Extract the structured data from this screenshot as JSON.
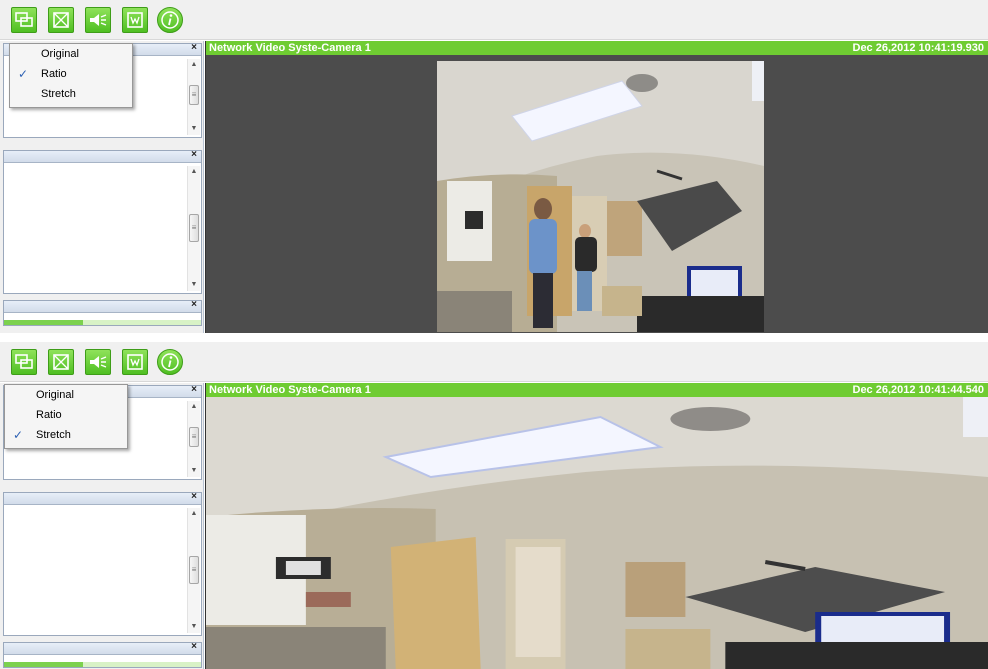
{
  "colors": {
    "accent_green": "#6fcc32",
    "video_background": "#4c4c4c",
    "toolbar_background": "#f0f0f0",
    "check_blue": "#2e62b4"
  },
  "toolbar": {
    "buttons": [
      {
        "icon": "monitor-layout-icon"
      },
      {
        "icon": "fullscreen-icon"
      },
      {
        "icon": "speaker-icon"
      },
      {
        "icon": "window-icon"
      },
      {
        "icon": "info-icon"
      }
    ]
  },
  "screens": [
    {
      "scale_menu": {
        "items": [
          "Original",
          "Ratio",
          "Stretch"
        ],
        "selected": "Ratio"
      },
      "panels": {
        "close_glyph": "×"
      },
      "video": {
        "camera_title": "Network Video Syste-Camera 1",
        "timestamp": "Dec 26,2012 10:41:19.930",
        "display_mode": "Ratio"
      }
    },
    {
      "scale_menu": {
        "items": [
          "Original",
          "Ratio",
          "Stretch"
        ],
        "selected": "Stretch"
      },
      "panels": {
        "close_glyph": "×"
      },
      "video": {
        "camera_title": "Network Video Syste-Camera 1",
        "timestamp": "Dec 26,2012 10:41:44.540",
        "display_mode": "Stretch"
      }
    }
  ]
}
